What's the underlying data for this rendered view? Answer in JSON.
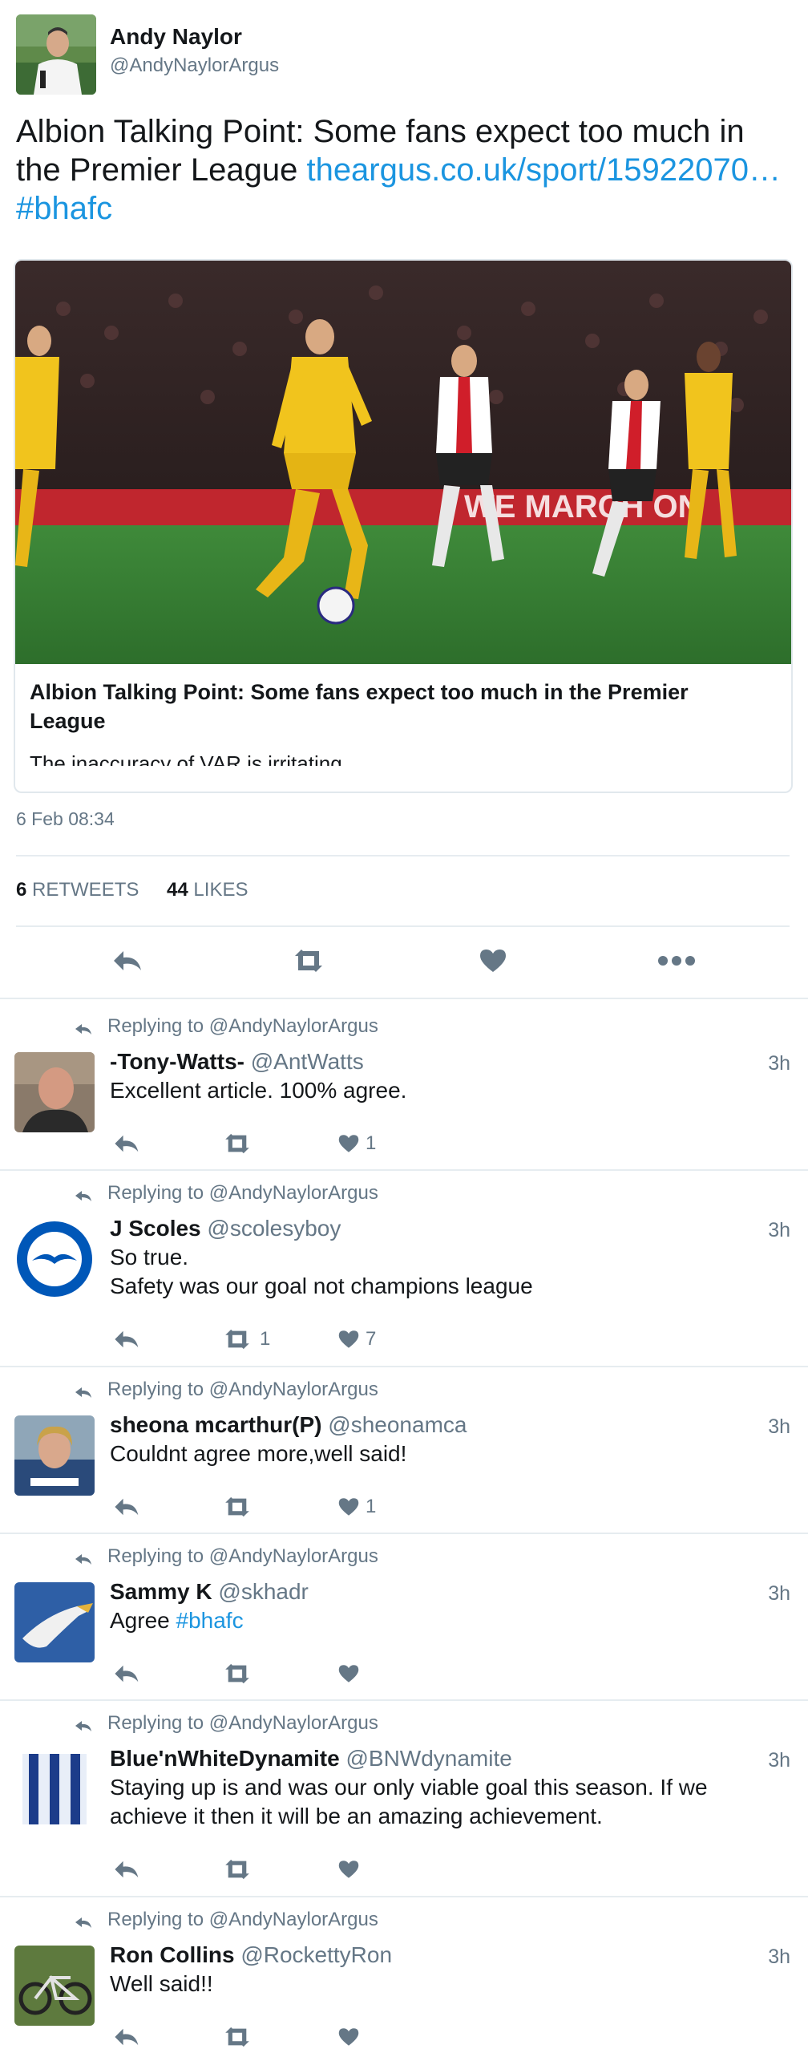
{
  "tweet": {
    "author_name": "Andy Naylor",
    "author_handle": "@AndyNaylorArgus",
    "text_plain": "Albion Talking Point: Some fans expect too much in the Premier League",
    "link": "theargus.co.uk/sport/15922070…",
    "hashtag": "#bhafc",
    "card": {
      "title": "Albion Talking Point: Some fans expect too much in the Premier League",
      "description": "The inaccuracy of VAR is irritating"
    },
    "timestamp": "6 Feb 08:34",
    "retweets": "6",
    "retweets_label": "RETWEETS",
    "likes": "44",
    "likes_label": "LIKES"
  },
  "replies": [
    {
      "context": "Replying to @AndyNaylorArgus",
      "name": "-Tony-Watts-",
      "handle": "@AntWatts",
      "time": "3h",
      "text_lines": [
        "Excellent article. 100% agree."
      ],
      "retweets": "",
      "likes": "1",
      "avatar": "man-photo"
    },
    {
      "context": "Replying to @AndyNaylorArgus",
      "name": "J Scoles",
      "handle": "@scolesyboy",
      "time": "3h",
      "text_lines": [
        "So true.",
        "Safety was our goal not champions league"
      ],
      "retweets": "1",
      "likes": "7",
      "avatar": "club-crest"
    },
    {
      "context": "Replying to @AndyNaylorArgus",
      "name": "sheona mcarthur(P)",
      "handle": "@sheonamca",
      "time": "3h",
      "text_lines": [
        "Couldnt agree more,well said!"
      ],
      "retweets": "",
      "likes": "1",
      "avatar": "woman-photo"
    },
    {
      "context": "Replying to @AndyNaylorArgus",
      "name": "Sammy K",
      "handle": "@skhadr",
      "time": "3h",
      "text_prefix": "Agree ",
      "text_hashtag": "#bhafc",
      "retweets": "",
      "likes": "",
      "avatar": "seagull-photo"
    },
    {
      "context": "Replying to @AndyNaylorArgus",
      "name": "Blue'nWhiteDynamite",
      "handle": "@BNWdynamite",
      "time": "3h",
      "text_lines": [
        "Staying up is and was our only viable goal this season. If we",
        "achieve it then it will be an amazing achievement."
      ],
      "retweets": "",
      "likes": "",
      "avatar": "striped-logo"
    },
    {
      "context": "Replying to @AndyNaylorArgus",
      "name": "Ron Collins",
      "handle": "@RockettyRon",
      "time": "3h",
      "text_lines": [
        "Well said!!"
      ],
      "retweets": "",
      "likes": "",
      "avatar": "bicycle-photo"
    }
  ]
}
